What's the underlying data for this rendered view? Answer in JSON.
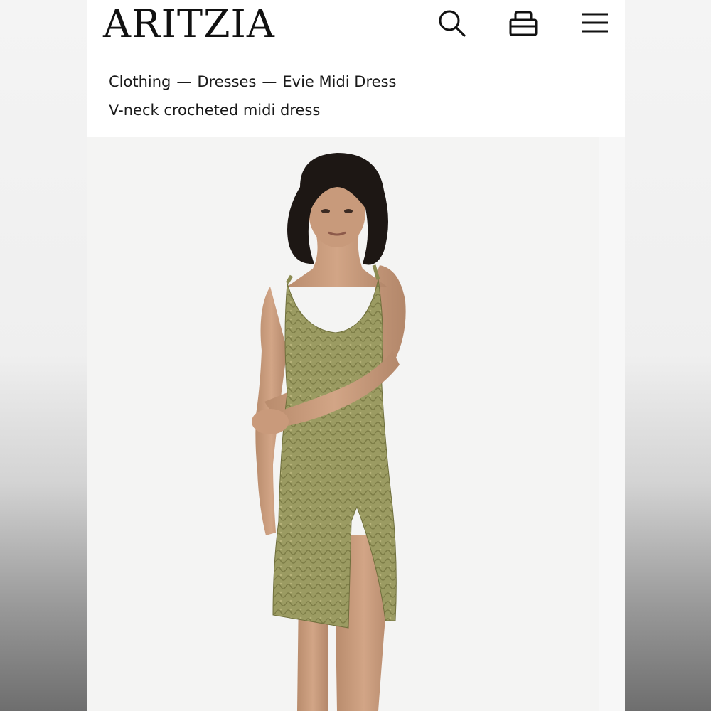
{
  "brand": {
    "logo_text": "ARITZIA"
  },
  "header": {
    "icons": [
      "search-icon",
      "bag-icon",
      "menu-icon"
    ]
  },
  "breadcrumb": {
    "items": [
      "Clothing",
      "Dresses",
      "Evie Midi Dress"
    ],
    "separator": "—"
  },
  "product": {
    "subtitle": "V-neck crocheted midi dress",
    "dress_color": "#9a9a5f"
  }
}
